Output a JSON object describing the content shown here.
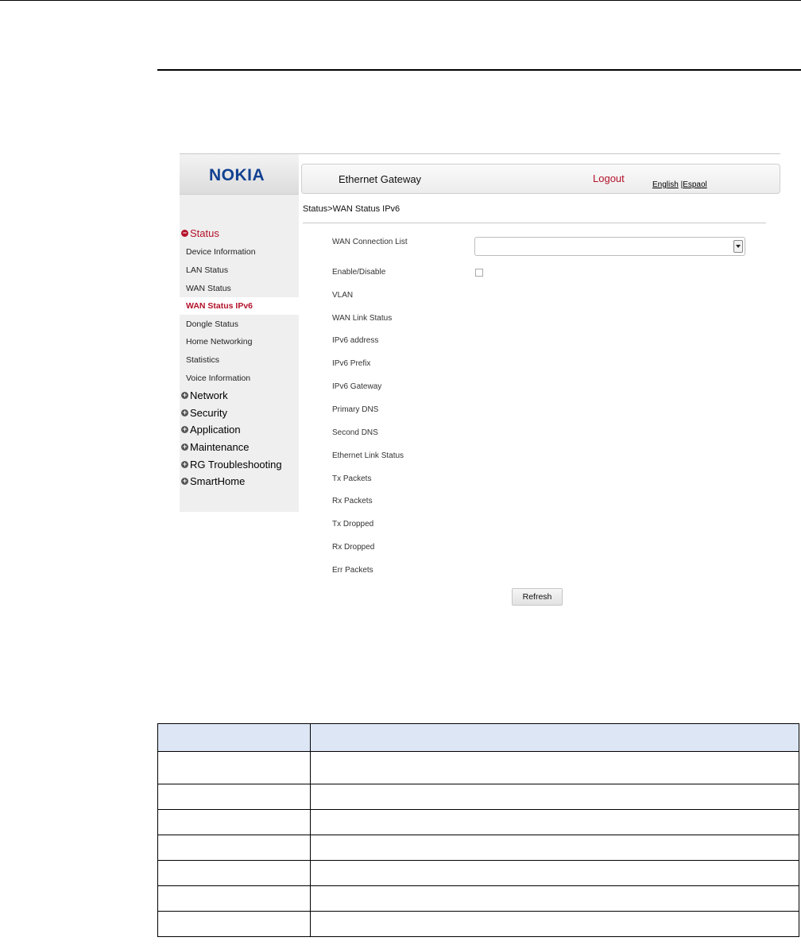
{
  "brand": {
    "logo_text": "NOKIA",
    "accent": "#b3122a",
    "logo_color": "#124191"
  },
  "header": {
    "title": "Ethernet Gateway",
    "logout": "Logout",
    "lang_english": "English",
    "lang_separator": "|",
    "lang_espanol": "Espaol"
  },
  "breadcrumb": "Status>WAN Status IPv6",
  "sidebar": {
    "status_group": "Status",
    "status_items": [
      "Device Information",
      "LAN Status",
      "WAN Status",
      "WAN Status IPv6",
      "Dongle Status",
      "Home Networking",
      "Statistics",
      "Voice Information"
    ],
    "other_groups": [
      "Network",
      "Security",
      "Application",
      "Maintenance",
      "RG Troubleshooting",
      "SmartHome"
    ]
  },
  "form": {
    "wan_connection_list": {
      "label": "WAN Connection List",
      "value": ""
    },
    "enable_disable": {
      "label": "Enable/Disable",
      "checked": false
    },
    "fields": [
      "VLAN",
      "WAN Link Status",
      "IPv6 address",
      "IPv6 Prefix",
      "IPv6 Gateway",
      "Primary DNS",
      "Second DNS",
      "Ethernet Link Status",
      "Tx Packets",
      "Rx Packets",
      "Tx Dropped",
      "Rx Dropped",
      "Err Packets"
    ],
    "refresh_label": "Refresh"
  }
}
